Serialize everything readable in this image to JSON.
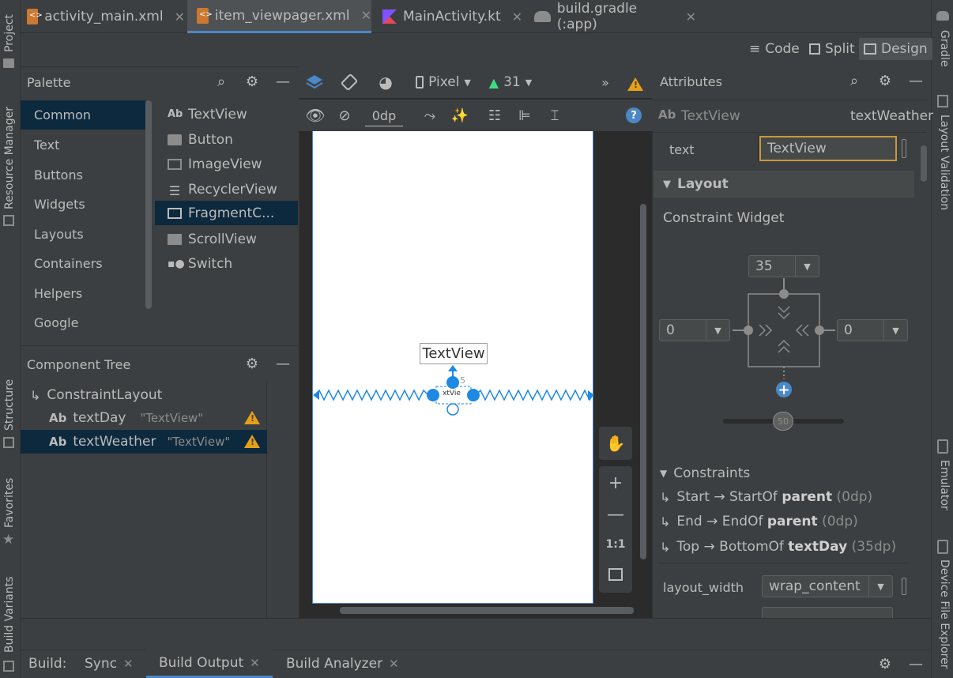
{
  "editor_tabs": [
    {
      "label": "activity_main.xml",
      "icon": "xml-file-icon",
      "active": false
    },
    {
      "label": "item_viewpager.xml",
      "icon": "xml-file-icon",
      "active": true
    },
    {
      "label": "MainActivity.kt",
      "icon": "kotlin-file-icon",
      "active": false
    },
    {
      "label": "build.gradle (:app)",
      "icon": "gradle-icon",
      "active": false
    }
  ],
  "view_modes": {
    "code": "Code",
    "split": "Split",
    "design": "Design"
  },
  "left_tool_windows": [
    "Project",
    "Resource Manager",
    "Structure",
    "Favorites",
    "Build Variants"
  ],
  "right_tool_windows": [
    "Gradle",
    "Layout Validation",
    "Emulator",
    "Device File Explorer"
  ],
  "palette": {
    "title": "Palette",
    "categories": [
      "Common",
      "Text",
      "Buttons",
      "Widgets",
      "Layouts",
      "Containers",
      "Helpers",
      "Google"
    ],
    "selected_category": "Common",
    "items": [
      {
        "label": "TextView",
        "icon": "textview-icon"
      },
      {
        "label": "Button",
        "icon": "button-icon"
      },
      {
        "label": "ImageView",
        "icon": "imageview-icon"
      },
      {
        "label": "RecyclerView",
        "icon": "recyclerview-icon"
      },
      {
        "label": "FragmentC...",
        "icon": "fragment-icon"
      },
      {
        "label": "ScrollView",
        "icon": "scrollview-icon"
      },
      {
        "label": "Switch",
        "icon": "switch-icon"
      }
    ]
  },
  "component_tree": {
    "title": "Component Tree",
    "root": "ConstraintLayout",
    "children": [
      {
        "id": "textDay",
        "text": "\"TextView\""
      },
      {
        "id": "textWeather",
        "text": "\"TextView\""
      }
    ]
  },
  "design_toolbar": {
    "device": "Pixel",
    "api": "31",
    "margin": "0dp"
  },
  "canvas": {
    "textview_label": "TextView",
    "margin_badge": "5",
    "selected_label": "xtVie"
  },
  "zoom_controls": {
    "fit": "1:1"
  },
  "attributes": {
    "title": "Attributes",
    "widget_type": "TextView",
    "widget_id": "textWeather",
    "text_label": "text",
    "text_value": "TextView",
    "layout_section": "Layout",
    "constraint_widget": "Constraint Widget",
    "margin_top": "35",
    "margin_start": "0",
    "margin_end": "0",
    "bias": "50",
    "constraints_title": "Constraints",
    "constraints": [
      {
        "side": "Start",
        "arrow": "→",
        "target": "StartOf",
        "ref": "parent",
        "value": "(0dp)"
      },
      {
        "side": "End",
        "arrow": "→",
        "target": "EndOf",
        "ref": "parent",
        "value": "(0dp)"
      },
      {
        "side": "Top",
        "arrow": "→",
        "target": "BottomOf",
        "ref": "textDay",
        "value": "(35dp)"
      }
    ],
    "layout_width_label": "layout_width",
    "layout_width_value": "wrap_content"
  },
  "build_bar": {
    "label": "Build:",
    "tabs": [
      "Sync",
      "Build Output",
      "Build Analyzer"
    ],
    "active": "Build Output"
  },
  "colors": {
    "accent": "#4a88c7",
    "warning": "#e6a017",
    "android_green": "#3ddc84",
    "blueprint": "#1e88e5"
  }
}
